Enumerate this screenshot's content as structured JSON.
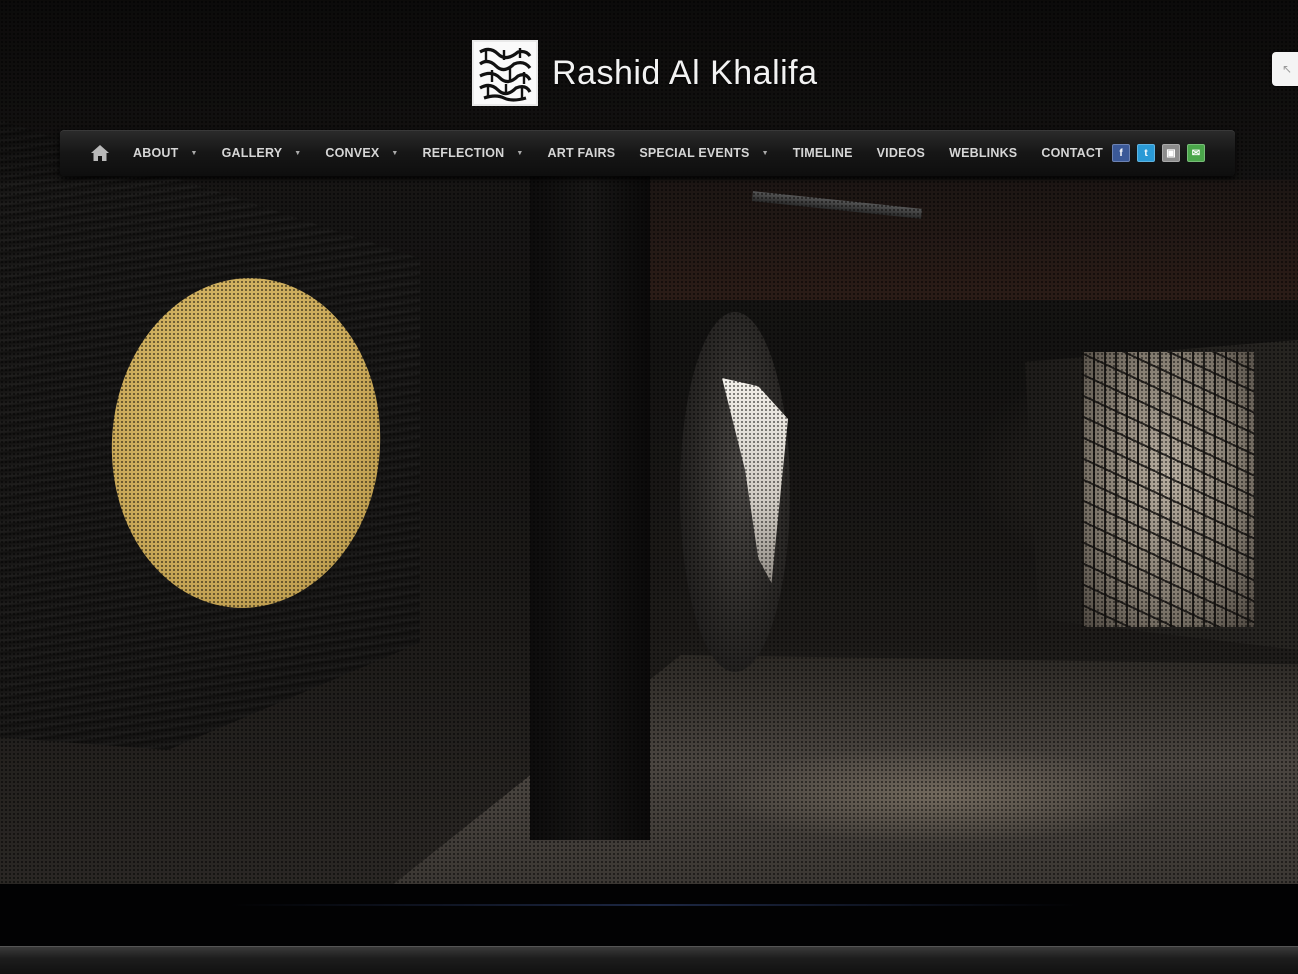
{
  "site": {
    "title": "Rashid Al Khalifa"
  },
  "nav": {
    "home_icon": "home-icon",
    "items": [
      {
        "label": "ABOUT",
        "has_dropdown": true
      },
      {
        "label": "GALLERY",
        "has_dropdown": true
      },
      {
        "label": "CONVEX",
        "has_dropdown": true
      },
      {
        "label": "REFLECTION",
        "has_dropdown": true
      },
      {
        "label": "ART FAIRS",
        "has_dropdown": false
      },
      {
        "label": "SPECIAL EVENTS",
        "has_dropdown": true
      },
      {
        "label": "TIMELINE",
        "has_dropdown": false
      },
      {
        "label": "VIDEOS",
        "has_dropdown": false
      },
      {
        "label": "WEBLINKS",
        "has_dropdown": false
      },
      {
        "label": "CONTACT",
        "has_dropdown": false
      }
    ],
    "dropdown_glyph": "▼"
  },
  "social": [
    {
      "name": "facebook-icon",
      "glyph": "f",
      "color": "#3b5998"
    },
    {
      "name": "twitter-icon",
      "glyph": "t",
      "color": "#2a9ad6"
    },
    {
      "name": "flickr-icon",
      "glyph": "▣",
      "color": "#8c8c8c"
    },
    {
      "name": "email-icon",
      "glyph": "✉",
      "color": "#4aa64a"
    }
  ],
  "colors": {
    "nav_background": "#161616",
    "nav_text": "#d6d6d6",
    "title_text": "#f2f2f2"
  }
}
